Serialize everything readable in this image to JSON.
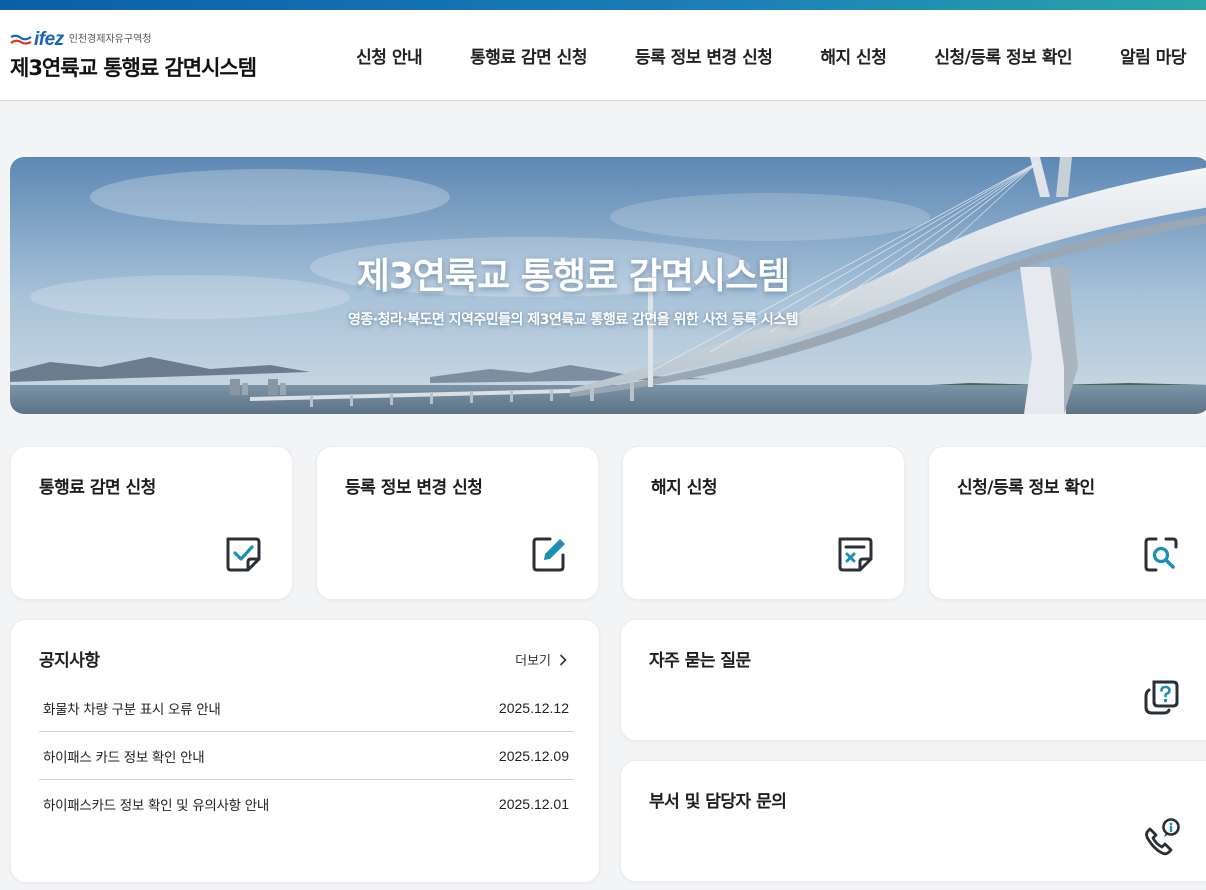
{
  "brand": {
    "logo_text": "ifez",
    "logo_sub": "인천경제자유구역청",
    "site_title": "제3연륙교 통행료 감면시스템"
  },
  "nav": {
    "items": [
      {
        "label": "신청 안내"
      },
      {
        "label": "통행료 감면 신청"
      },
      {
        "label": "등록 정보 변경 신청"
      },
      {
        "label": "해지 신청"
      },
      {
        "label": "신청/등록 정보 확인"
      },
      {
        "label": "알림 마당"
      }
    ]
  },
  "hero": {
    "title": "제3연륙교 통행료 감면시스템",
    "subtitle": "영종·청라·북도면 지역주민들의 제3연륙교 통행료 감면을 위한 사전 등록 시스템"
  },
  "quick_cards": [
    {
      "label": "통행료 감면 신청",
      "icon": "check-square-icon"
    },
    {
      "label": "등록 정보 변경 신청",
      "icon": "edit-pencil-icon"
    },
    {
      "label": "해지 신청",
      "icon": "cancel-document-icon"
    },
    {
      "label": "신청/등록 정보 확인",
      "icon": "search-magnifier-icon"
    }
  ],
  "notice": {
    "title": "공지사항",
    "more_label": "더보기",
    "items": [
      {
        "title": "화물차 차량 구분 표시 오류 안내",
        "date": "2025.12.12"
      },
      {
        "title": "하이패스 카드 정보 확인 안내",
        "date": "2025.12.09"
      },
      {
        "title": "하이패스카드 정보 확인 및 유의사항 안내",
        "date": "2025.12.01"
      }
    ]
  },
  "faq": {
    "label": "자주 묻는 질문",
    "icon": "question-bubble-icon"
  },
  "contact": {
    "label": "부서 및 담당자 문의",
    "icon": "phone-info-icon"
  },
  "colors": {
    "accent": "#1a6fa6",
    "icon_teal": "#1b8fb5",
    "icon_dark": "#2b2f36",
    "topbar_start": "#0b5ea8",
    "topbar_end": "#2aa5a8"
  }
}
